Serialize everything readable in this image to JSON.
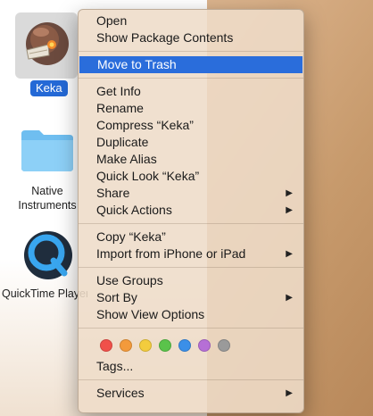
{
  "desktop": {
    "items": [
      {
        "name": "Keka",
        "icon": "keka-app-icon"
      },
      {
        "name": "Native Instruments",
        "icon": "folder-icon"
      },
      {
        "name": "QuickTime Player",
        "icon": "quicktime-icon"
      }
    ]
  },
  "menu": {
    "group1": [
      {
        "label": "Open",
        "submenu": false
      },
      {
        "label": "Show Package Contents",
        "submenu": false
      }
    ],
    "highlighted": {
      "label": "Move to Trash"
    },
    "group2": [
      {
        "label": "Get Info",
        "submenu": false
      },
      {
        "label": "Rename",
        "submenu": false
      },
      {
        "label": "Compress “Keka”",
        "submenu": false
      },
      {
        "label": "Duplicate",
        "submenu": false
      },
      {
        "label": "Make Alias",
        "submenu": false
      },
      {
        "label": "Quick Look “Keka”",
        "submenu": false
      },
      {
        "label": "Share",
        "submenu": true
      },
      {
        "label": "Quick Actions",
        "submenu": true
      }
    ],
    "group3": [
      {
        "label": "Copy “Keka”",
        "submenu": false
      },
      {
        "label": "Import from iPhone or iPad",
        "submenu": true
      }
    ],
    "group4": [
      {
        "label": "Use Groups",
        "submenu": false
      },
      {
        "label": "Sort By",
        "submenu": true
      },
      {
        "label": "Show View Options",
        "submenu": false
      }
    ],
    "tags": {
      "colors": [
        {
          "name": "red",
          "hex": "#f0504a"
        },
        {
          "name": "orange",
          "hex": "#f39a3b"
        },
        {
          "name": "yellow",
          "hex": "#f3cc3d"
        },
        {
          "name": "green",
          "hex": "#5ac34b"
        },
        {
          "name": "blue",
          "hex": "#3b8fe8"
        },
        {
          "name": "purple",
          "hex": "#b66fd6"
        },
        {
          "name": "gray",
          "hex": "#9a9a9a"
        }
      ],
      "label": "Tags..."
    },
    "services": {
      "label": "Services",
      "submenu": true
    },
    "accent_color": "#2a6ddb"
  }
}
